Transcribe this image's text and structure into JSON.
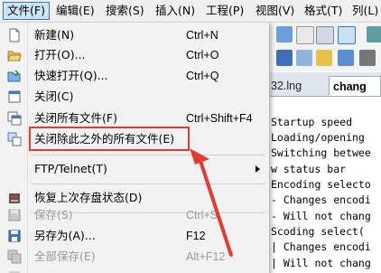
{
  "menubar": {
    "items": [
      "文件(F)",
      "编辑(E)",
      "搜索(S)",
      "插入(N)",
      "工程(P)",
      "视图(V)",
      "格式(T)",
      "列(L)"
    ]
  },
  "tabs": {
    "items": [
      "32.lng",
      "chang"
    ]
  },
  "editor": {
    "lines": [
      "Startup speed",
      "Loading/opening",
      "Switching betwee",
      "w status bar",
      "Encoding selecto",
      "- Changes encodi",
      "- Will not chang",
      "Scoding select(",
      "| Changes encodi",
      "| Will not chang"
    ]
  },
  "menu": {
    "new": {
      "label": "新建(N)",
      "shortcut": "Ctrl+N"
    },
    "open": {
      "label": "打开(O)...",
      "shortcut": "Ctrl+O"
    },
    "quick_open": {
      "label": "快速打开(Q)...",
      "shortcut": "Ctrl+Q"
    },
    "close": {
      "label": "关闭(C)"
    },
    "close_all": {
      "label": "关闭所有文件(F)",
      "shortcut": "Ctrl+Shift+F4"
    },
    "close_others": {
      "label": "关闭除此之外的所有文件(E)"
    },
    "ftp": {
      "label": "FTP/Telnet(T)"
    },
    "restore": {
      "label": "恢复上次存盘状态(D)"
    },
    "save": {
      "label": "保存(S)",
      "shortcut": "Ctrl+S"
    },
    "save_as": {
      "label": "另存为(A)...",
      "shortcut": "F12"
    },
    "save_all": {
      "label": "全部保存(E)",
      "shortcut": "Alt+F12"
    }
  },
  "colors": {
    "highlight": "#e53935",
    "menubar_active": "#cce4f7"
  }
}
